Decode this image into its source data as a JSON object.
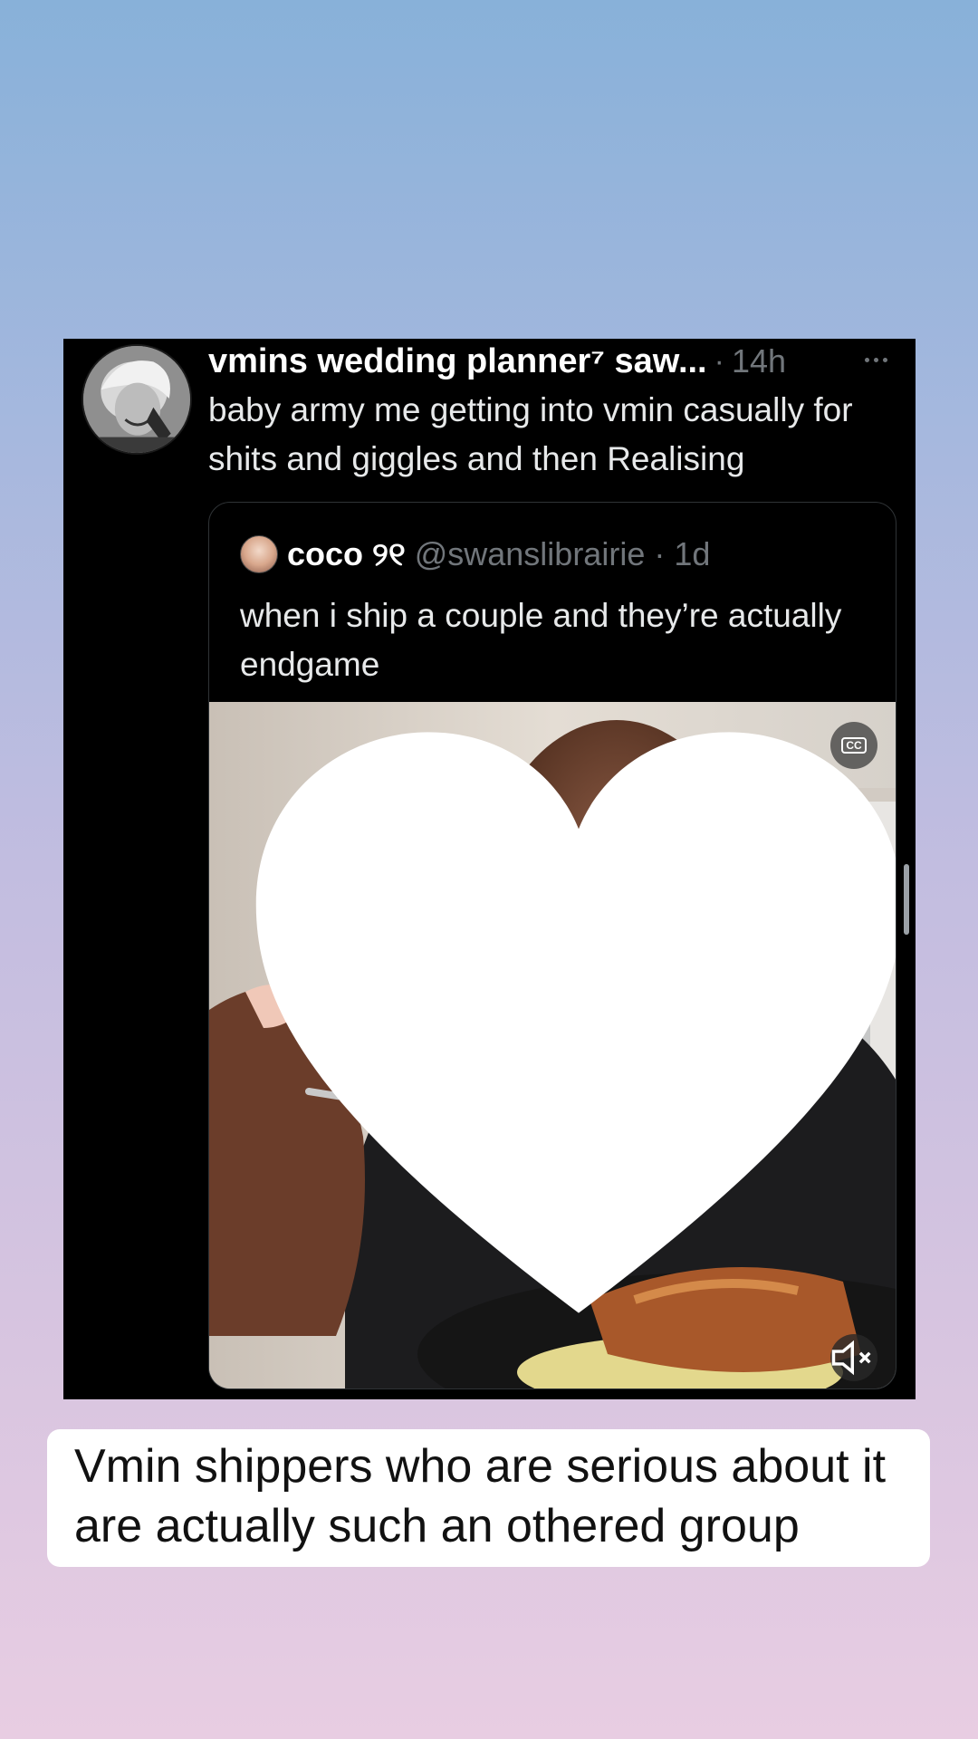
{
  "tweet": {
    "display_name": "vmins wedding planner⁷ saw...",
    "separator": "·",
    "time": "14h",
    "text": "baby army me getting into vmin casually for shits and giggles and then Realising"
  },
  "quoted_tweet": {
    "display_name": "coco ୨୧",
    "handle": "@swanslibrairie",
    "separator": "·",
    "time": "1d",
    "text": "when i ship a couple and they’re actually endgame",
    "video": {
      "cc_label": "CC"
    }
  },
  "caption": {
    "text": "Vmin shippers who are serious about it are actually such an othered group"
  },
  "icons": {
    "more": "more-horizontal-icon",
    "cc": "closed-captions-icon",
    "mute": "speaker-muted-icon",
    "like": "heart-icon"
  },
  "colors": {
    "card_background": "#000000",
    "secondary_text": "#71767b",
    "primary_text": "#e7e9ea",
    "caption_background": "#ffffff"
  }
}
